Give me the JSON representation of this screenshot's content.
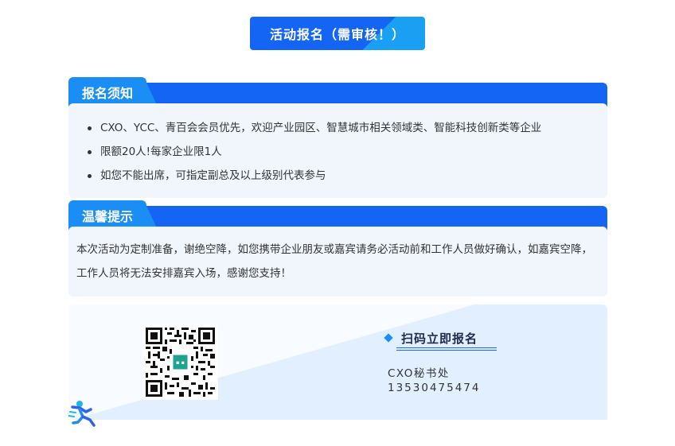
{
  "header": {
    "title": "活动报名（需审核！）"
  },
  "notice": {
    "tab_label": "报名须知",
    "items": [
      "CXO、YCC、青百会会员优先，欢迎产业园区、智慧城市相关领域类、智能科技创新类等企业",
      "限额20人!每家企业限1人",
      "如您不能出席，可指定副总及以上级别代表参与"
    ]
  },
  "tips": {
    "tab_label": "温馨提示",
    "text": "本次活动为定制准备，谢绝空降，如您携带企业朋友或嘉宾请务必活动前和工作人员做好确认，如嘉宾空降，工作人员将无法安排嘉宾入场，感谢您支持！"
  },
  "signup": {
    "qr_icon": "qr-code",
    "scan_title": "扫码立即报名",
    "contact_name": "CXO秘书处",
    "contact_phone": "13530475474"
  },
  "colors": {
    "primary": "#1565f5",
    "accent": "#1a8ef5",
    "panel_bg": "#f1f6fc",
    "signup_bg": "#e2efff"
  },
  "decor": {
    "runner_icon": "runner-icon",
    "diamond_icon": "diamond-icon"
  }
}
